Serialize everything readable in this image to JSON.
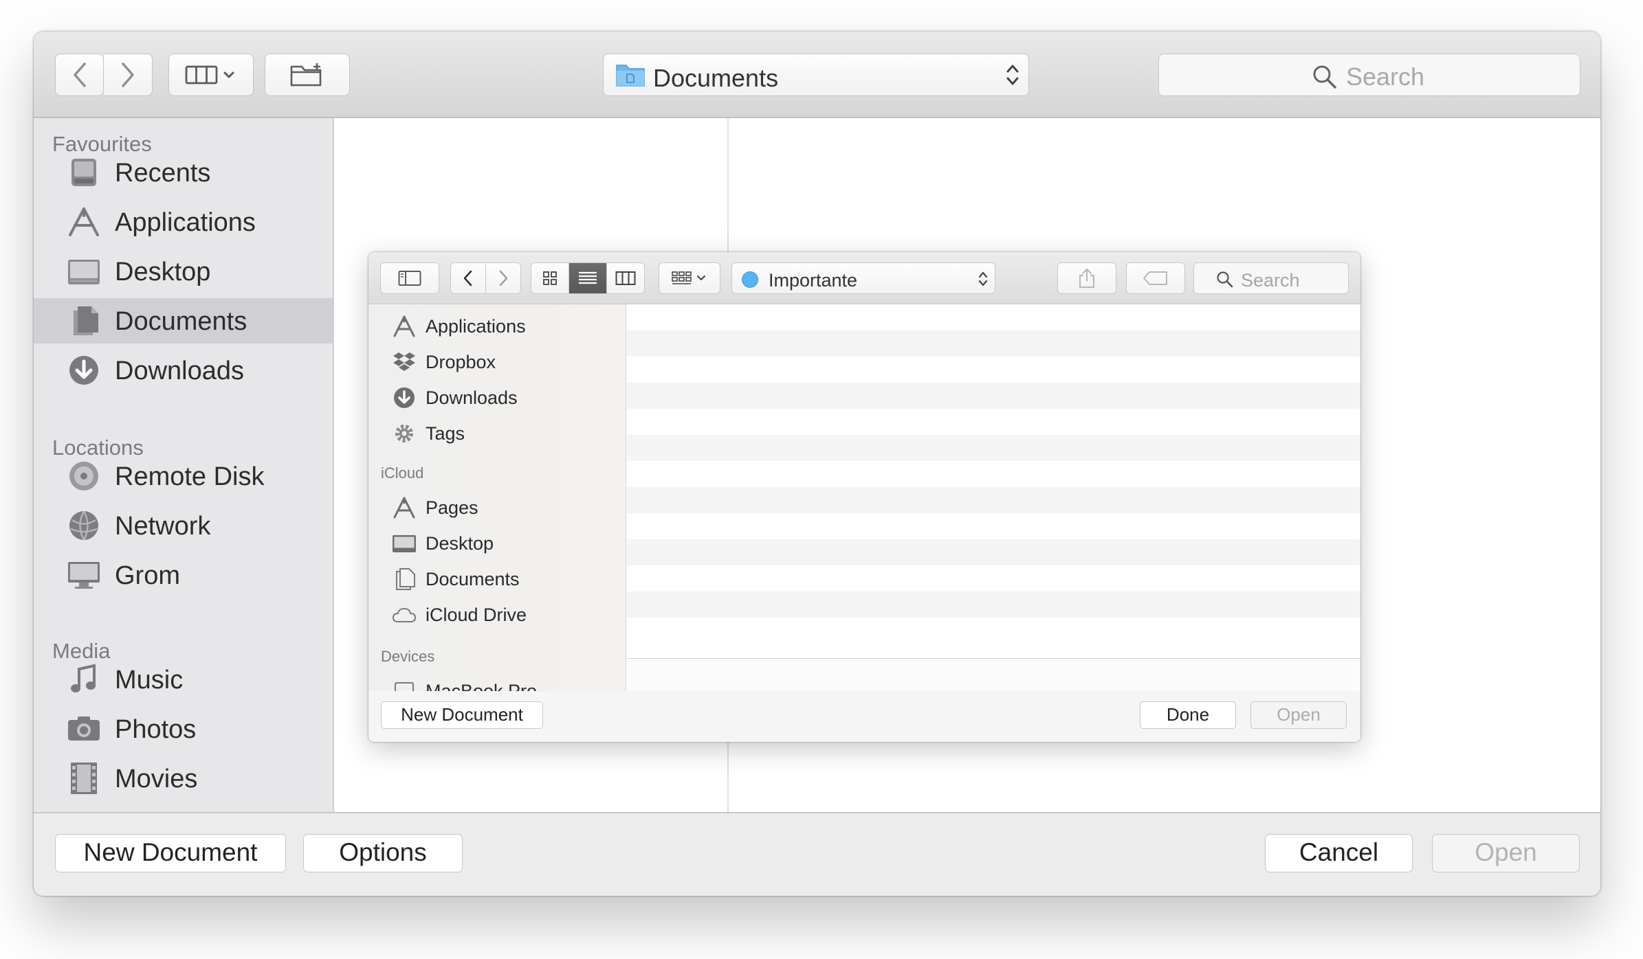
{
  "outer_dialog": {
    "toolbar": {
      "back_icon": "chevron-left-icon",
      "forward_icon": "chevron-right-icon",
      "view_menu_icon": "column-view-icon",
      "new_folder_icon": "new-folder-icon",
      "location": "Documents",
      "search_placeholder": "Search"
    },
    "sidebar": {
      "sections": [
        {
          "title": "Favourites",
          "items": [
            {
              "label": "Recents",
              "icon": "recents-icon"
            },
            {
              "label": "Applications",
              "icon": "applications-icon"
            },
            {
              "label": "Desktop",
              "icon": "desktop-icon"
            },
            {
              "label": "Documents",
              "icon": "documents-icon",
              "selected": true
            },
            {
              "label": "Downloads",
              "icon": "downloads-icon"
            }
          ]
        },
        {
          "title": "Locations",
          "items": [
            {
              "label": "Remote Disk",
              "icon": "remote-disk-icon"
            },
            {
              "label": "Network",
              "icon": "network-icon"
            },
            {
              "label": "Grom",
              "icon": "computer-icon"
            }
          ]
        },
        {
          "title": "Media",
          "items": [
            {
              "label": "Music",
              "icon": "music-icon"
            },
            {
              "label": "Photos",
              "icon": "photos-icon"
            },
            {
              "label": "Movies",
              "icon": "movies-icon"
            }
          ]
        }
      ]
    },
    "footer": {
      "new_document": "New Document",
      "options": "Options",
      "cancel": "Cancel",
      "open": "Open"
    }
  },
  "inner_dialog": {
    "toolbar": {
      "location": "Importante",
      "location_tag_color": "#5ab2f0",
      "search_placeholder": "Search"
    },
    "sidebar": {
      "favourites": [
        {
          "label": "Applications",
          "icon": "applications-icon"
        },
        {
          "label": "Dropbox",
          "icon": "dropbox-icon"
        },
        {
          "label": "Downloads",
          "icon": "downloads-icon"
        },
        {
          "label": "Tags",
          "icon": "gear-icon"
        }
      ],
      "icloud_title": "iCloud",
      "icloud": [
        {
          "label": "Pages",
          "icon": "pages-app-icon"
        },
        {
          "label": "Desktop",
          "icon": "desktop-icon"
        },
        {
          "label": "Documents",
          "icon": "documents-icon"
        },
        {
          "label": "iCloud Drive",
          "icon": "cloud-icon"
        }
      ],
      "devices_title": "Devices",
      "devices": [
        {
          "label": "MacBook Pro",
          "icon": "laptop-icon"
        }
      ]
    },
    "footer": {
      "new_document": "New Document",
      "done": "Done",
      "open": "Open"
    }
  }
}
